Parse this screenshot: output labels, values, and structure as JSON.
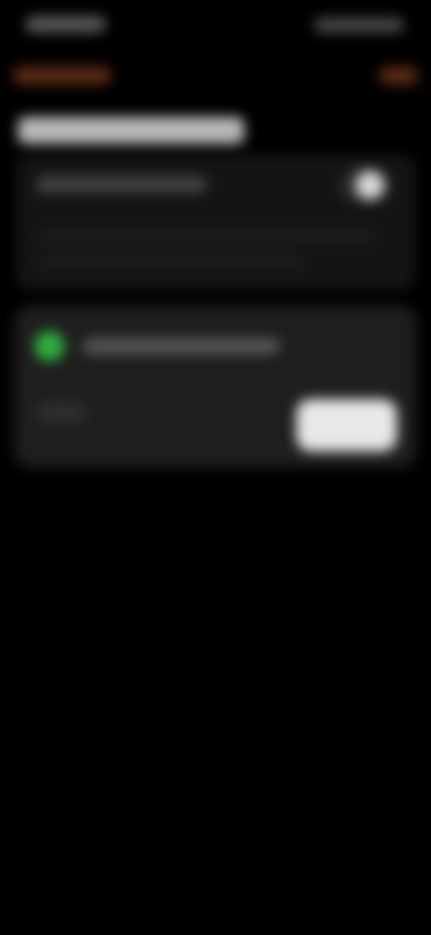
{
  "status_bar": {
    "time": "",
    "icons": [
      "signal-icon",
      "wifi-icon",
      "battery-icon"
    ]
  },
  "nav": {
    "back_label": "",
    "action_label": ""
  },
  "section": {
    "title": ""
  },
  "settings": {
    "toggle_label": "",
    "toggle_on": true
  },
  "card": {
    "title": "",
    "subtitle": "",
    "button_label": ""
  },
  "colors": {
    "background": "#000000",
    "group": "#141414",
    "card": "#1e1e1e",
    "accent": "#5a2a14",
    "status_green": "#2fae3e",
    "button": "#e8e8e8"
  }
}
